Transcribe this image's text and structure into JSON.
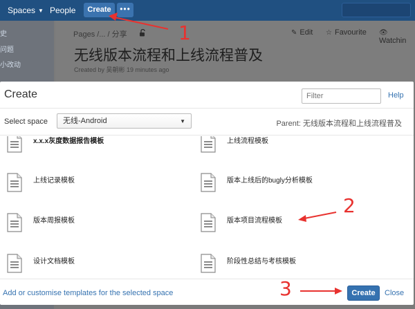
{
  "topbar": {
    "spaces_label": "Spaces",
    "people_label": "People",
    "create_label": "Create",
    "more_label": "•••"
  },
  "sidebar": {
    "links": [
      "史",
      "问题",
      "小改动"
    ]
  },
  "page": {
    "breadcrumb": "Pages /... / 分享",
    "actions": {
      "edit": "Edit",
      "favourite": "Favourite",
      "watching": "Watchin"
    },
    "title": "无线版本流程和上线流程普及",
    "byline": "Created by 吴朝彬 19 minutes ago"
  },
  "annotations": {
    "one": "1",
    "two": "2",
    "three": "3"
  },
  "dialog": {
    "title": "Create",
    "filter_placeholder": "Filter",
    "help_label": "Help",
    "select_label": "Select space",
    "selected_space": "无线-Android",
    "parent_text": "Parent: 无线版本流程和上线流程普及",
    "templates": [
      "x.x.x灰度数据报告模板",
      "上线流程模板",
      "上线记录模板",
      "版本上线后的bugly分析模板",
      "版本周报模板",
      "版本项目流程模板",
      "设计文档模板",
      "阶段性总结与考核模板"
    ],
    "customise_link": "Add or customise templates for the selected space",
    "create_button": "Create",
    "close_label": "Close"
  }
}
